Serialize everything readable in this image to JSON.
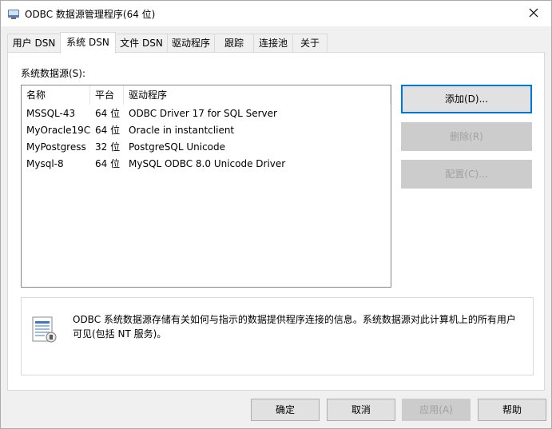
{
  "window": {
    "title": "ODBC 数据源管理程序(64 位)"
  },
  "tabs": [
    {
      "label": "用户 DSN"
    },
    {
      "label": "系统 DSN"
    },
    {
      "label": "文件 DSN"
    },
    {
      "label": "驱动程序"
    },
    {
      "label": "跟踪"
    },
    {
      "label": "连接池"
    },
    {
      "label": "关于"
    }
  ],
  "active_tab": "系统 DSN",
  "system_dsn": {
    "section_label": "系统数据源(S):",
    "columns": [
      "名称",
      "平台",
      "驱动程序"
    ],
    "rows": [
      {
        "name": "MSSQL-43",
        "platform": "64 位",
        "driver": "ODBC Driver 17 for SQL Server"
      },
      {
        "name": "MyOracle19C",
        "platform": "64 位",
        "driver": "Oracle in instantclient"
      },
      {
        "name": "MyPostgress",
        "platform": "32 位",
        "driver": "PostgreSQL Unicode"
      },
      {
        "name": "Mysql-8",
        "platform": "64 位",
        "driver": "MySQL ODBC 8.0 Unicode Driver"
      }
    ],
    "buttons": {
      "add": "添加(D)...",
      "remove": "删除(R)",
      "configure": "配置(C)..."
    },
    "info_text": "ODBC 系统数据源存储有关如何与指示的数据提供程序连接的信息。系统数据源对此计算机上的所有用户可见(包括 NT 服务)。"
  },
  "footer": {
    "ok": "确定",
    "cancel": "取消",
    "apply": "应用(A)",
    "help": "帮助"
  },
  "colors": {
    "accent": "#0078d7",
    "disabled_text": "#a0a0a0"
  }
}
